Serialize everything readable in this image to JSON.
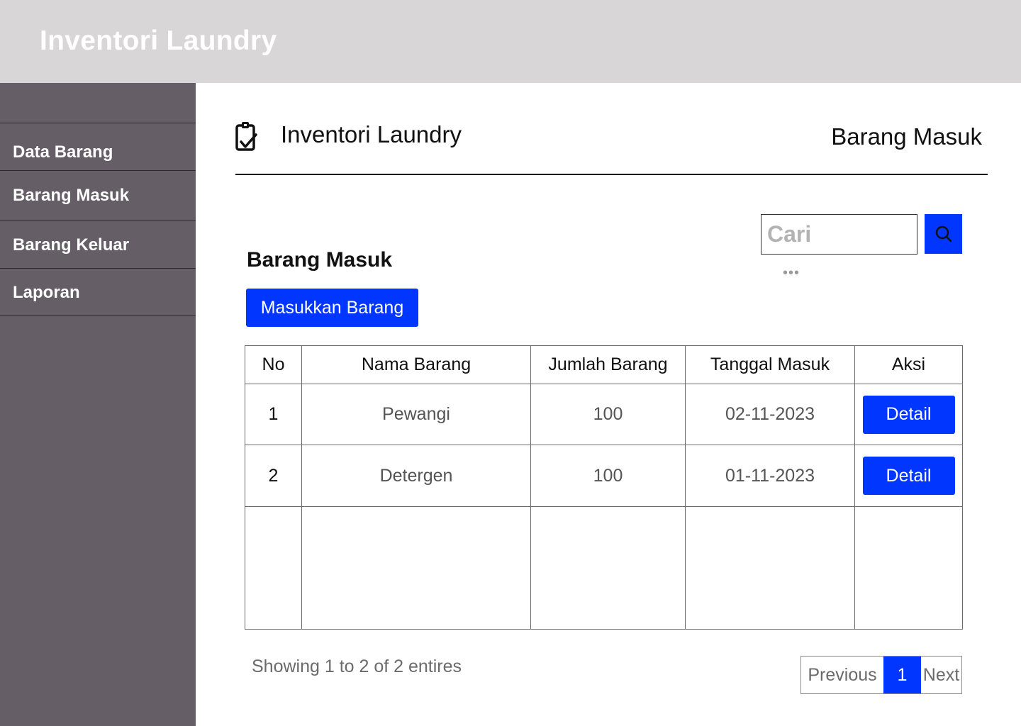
{
  "app": {
    "title": "Inventori Laundry"
  },
  "sidebar": {
    "items": [
      {
        "label": "Data Barang"
      },
      {
        "label": "Barang Masuk"
      },
      {
        "label": "Barang Keluar"
      },
      {
        "label": "Laporan"
      }
    ]
  },
  "header": {
    "brand": "Inventori Laundry",
    "brand_icon": "clipboard-check-icon",
    "page_title": "Barang Masuk"
  },
  "search": {
    "placeholder": "Cari",
    "value": "",
    "icon": "search-icon"
  },
  "more_icon": "•••",
  "section": {
    "title": "Barang Masuk",
    "add_button": "Masukkan Barang"
  },
  "table": {
    "columns": [
      "No",
      "Nama Barang",
      "Jumlah Barang",
      "Tanggal Masuk",
      "Aksi"
    ],
    "rows": [
      {
        "no": "1",
        "nama": "Pewangi",
        "jumlah": "100",
        "tanggal": "02-11-2023",
        "aksi": "Detail"
      },
      {
        "no": "2",
        "nama": "Detergen",
        "jumlah": "100",
        "tanggal": "01-11-2023",
        "aksi": "Detail"
      }
    ]
  },
  "footer": {
    "info": "Showing 1 to 2 of 2 entires",
    "pagination": {
      "previous": "Previous",
      "current": "1",
      "next": "Next"
    }
  },
  "colors": {
    "accent": "#0036ff",
    "sidebar": "#655e66",
    "topbar": "#d8d6d7"
  }
}
